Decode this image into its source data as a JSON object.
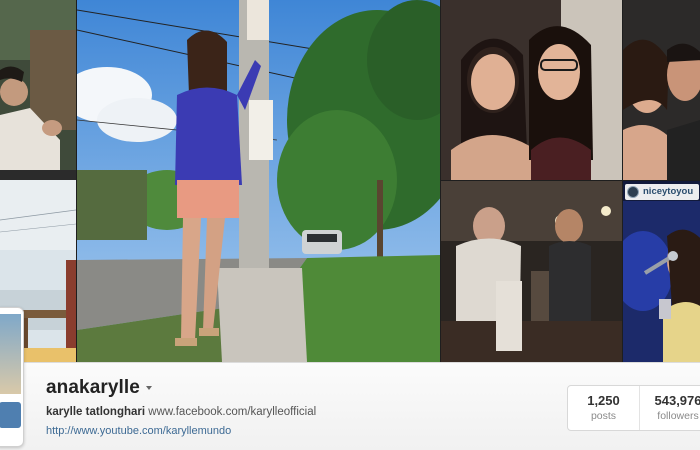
{
  "grid": {
    "tiles": [
      {
        "id": "left-top",
        "subject": "man-seated-at-cafe"
      },
      {
        "id": "left-bottom",
        "subject": "beach-boardwalk"
      },
      {
        "id": "feature",
        "subject": "woman-posing-by-utility-pole"
      },
      {
        "id": "r1",
        "subject": "two-women-selfie"
      },
      {
        "id": "r2",
        "subject": "couple-selfie"
      },
      {
        "id": "r3",
        "subject": "men-at-restaurant-night"
      },
      {
        "id": "r4",
        "subject": "singer-on-stage"
      }
    ],
    "overlay_username": "niceytoyou"
  },
  "profile": {
    "username": "anakarylle",
    "full_name": "karylle tatlonghari",
    "bio_link": "www.facebook.com/karylleofficial",
    "website": "http://www.youtube.com/karyllemundo"
  },
  "stats": {
    "posts_value": "1,250",
    "posts_label": "posts",
    "followers_value": "543,976",
    "followers_label": "followers"
  },
  "colors": {
    "link": "#3d6a94",
    "username": "#222222"
  }
}
